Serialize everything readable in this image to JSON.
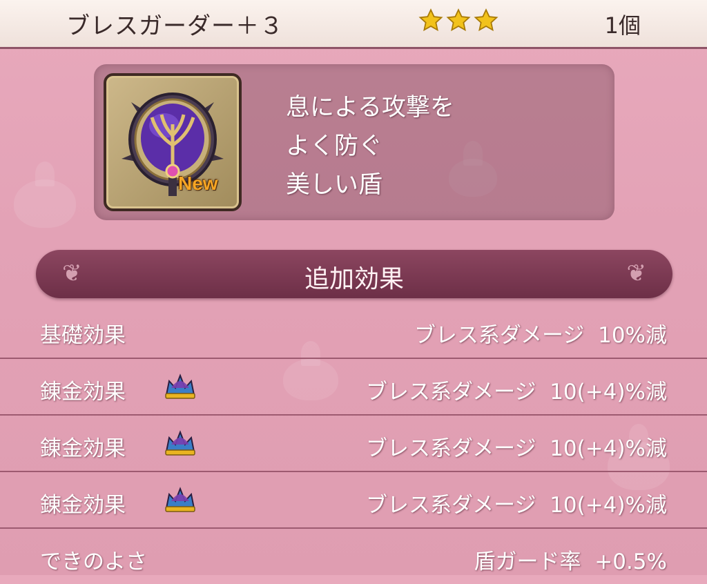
{
  "header": {
    "title": "ブレスガーダー＋３",
    "rarity_stars": 3,
    "star_icon": "star-icon",
    "count": "1個"
  },
  "item": {
    "icon": "breath-shield-icon",
    "new_badge": "New",
    "description": [
      "息による攻撃を",
      "よく防ぐ",
      "美しい盾"
    ]
  },
  "section": {
    "title": "追加効果"
  },
  "effects": [
    {
      "label": "基礎効果",
      "icon": null,
      "value": "ブレス系ダメージ  10%減"
    },
    {
      "label": "錬金効果",
      "icon": "crown-icon",
      "value": "ブレス系ダメージ  10(+4)%減"
    },
    {
      "label": "錬金効果",
      "icon": "crown-icon",
      "value": "ブレス系ダメージ  10(+4)%減"
    },
    {
      "label": "錬金効果",
      "icon": "crown-icon",
      "value": "ブレス系ダメージ  10(+4)%減"
    },
    {
      "label": "できのよさ",
      "icon": null,
      "value": "盾ガード率  +0.5%"
    }
  ],
  "colors": {
    "background": "#e3a2b6",
    "banner": "#7a3850",
    "star": "#f2c21b"
  }
}
